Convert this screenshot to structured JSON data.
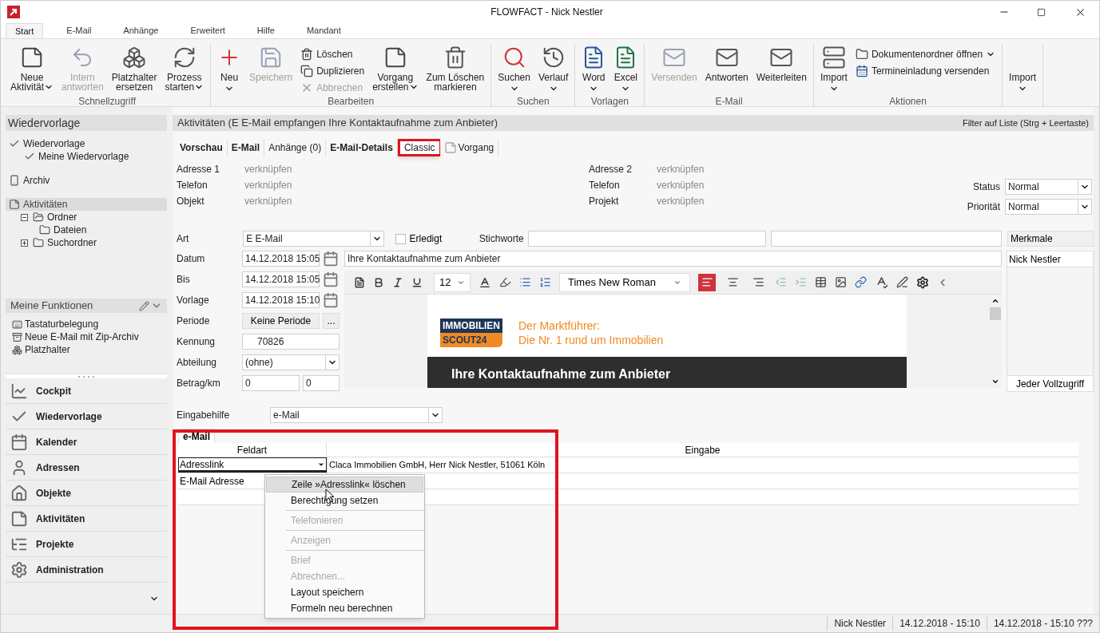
{
  "window": {
    "title": "FLOWFACT - Nick Nestler"
  },
  "ribbon_tabs": [
    {
      "label": "Start",
      "selected": true
    },
    {
      "label": "E-Mail",
      "selected": false
    },
    {
      "label": "Anhänge",
      "selected": false
    },
    {
      "label": "Erweitert",
      "selected": false
    },
    {
      "label": "Hilfe",
      "selected": false
    },
    {
      "label": "Mandant",
      "selected": false
    }
  ],
  "ribbon_groups": [
    {
      "label": "Schnellzugriff",
      "items": [
        {
          "kind": "large",
          "lines": [
            "Neue",
            "Aktivität"
          ],
          "dropdown": true,
          "disabled": false
        },
        {
          "kind": "large",
          "lines": [
            "Intern",
            "antworten"
          ],
          "dropdown": false,
          "disabled": true
        },
        {
          "kind": "large",
          "lines": [
            "Platzhalter",
            "ersetzen"
          ],
          "dropdown": false,
          "disabled": false
        },
        {
          "kind": "large",
          "lines": [
            "Prozess",
            "starten"
          ],
          "dropdown": true,
          "disabled": false
        }
      ]
    },
    {
      "label": "Bearbeiten",
      "items": [
        {
          "kind": "large",
          "lines": [
            "Neu"
          ],
          "dropdown": true,
          "disabled": false
        },
        {
          "kind": "large",
          "lines": [
            "Speichern"
          ],
          "dropdown": false,
          "disabled": true
        },
        {
          "kind": "small",
          "lines": [
            "Löschen"
          ],
          "dropdown": false,
          "disabled": false
        },
        {
          "kind": "small",
          "lines": [
            "Duplizieren"
          ],
          "dropdown": false,
          "disabled": false
        },
        {
          "kind": "small",
          "lines": [
            "Abbrechen"
          ],
          "dropdown": false,
          "disabled": true
        },
        {
          "kind": "large",
          "lines": [
            "Vorgang",
            "erstellen"
          ],
          "dropdown": true,
          "disabled": false
        },
        {
          "kind": "large",
          "lines": [
            "Zum Löschen",
            "markieren"
          ],
          "dropdown": false,
          "disabled": false
        }
      ]
    },
    {
      "label": "Suchen",
      "items": [
        {
          "kind": "large",
          "lines": [
            "Suchen"
          ],
          "dropdown": true,
          "disabled": false
        },
        {
          "kind": "large",
          "lines": [
            "Verlauf"
          ],
          "dropdown": true,
          "disabled": false
        }
      ]
    },
    {
      "label": "Vorlagen",
      "items": [
        {
          "kind": "large",
          "lines": [
            "Word"
          ],
          "dropdown": true,
          "disabled": false
        },
        {
          "kind": "large",
          "lines": [
            "Excel"
          ],
          "dropdown": true,
          "disabled": false
        }
      ]
    },
    {
      "label": "E-Mail",
      "items": [
        {
          "kind": "large",
          "lines": [
            "Versenden"
          ],
          "dropdown": false,
          "disabled": true
        },
        {
          "kind": "large",
          "lines": [
            "Antworten"
          ],
          "dropdown": false,
          "disabled": false
        },
        {
          "kind": "large",
          "lines": [
            "Weiterleiten"
          ],
          "dropdown": false,
          "disabled": false
        }
      ]
    },
    {
      "label": "Aktionen",
      "items": [
        {
          "kind": "large",
          "lines": [
            "Import"
          ],
          "dropdown": true,
          "disabled": false
        },
        {
          "kind": "small",
          "lines": [
            "Dokumentenordner öffnen"
          ],
          "dropdown": true,
          "disabled": false
        },
        {
          "kind": "small",
          "lines": [
            "Termineinladung versenden"
          ],
          "dropdown": false,
          "disabled": false
        }
      ]
    },
    {
      "items": [
        {
          "kind": "large",
          "lines": [
            "Import"
          ],
          "dropdown": true,
          "disabled": false
        }
      ]
    }
  ],
  "sidebar": {
    "title": "Wiedervorlage",
    "tree": [
      {
        "label": "Wiedervorlage",
        "selected": false,
        "children": [
          {
            "label": "Meine Wiedervorlage"
          }
        ]
      },
      {
        "label": "Archiv",
        "selected": false
      },
      {
        "label": "Aktivitäten",
        "selected": true,
        "children": [
          {
            "label": "Ordner",
            "expanded": true,
            "children": [
              {
                "label": "Dateien"
              }
            ]
          },
          {
            "label": "Suchordner",
            "expanded": false
          }
        ]
      }
    ],
    "functions": {
      "title": "Meine Funktionen",
      "items": [
        "Tastaturbelegung",
        "Neue E-Mail mit Zip-Archiv",
        "Platzhalter"
      ]
    },
    "nav": [
      "Cockpit",
      "Wiedervorlage",
      "Kalender",
      "Adressen",
      "Objekte",
      "Aktivitäten",
      "Projekte",
      "Administration"
    ]
  },
  "panel": {
    "title": "Aktivitäten (E E-Mail empfangen Ihre Kontaktaufnahme zum Anbieter)",
    "filter_hint": "Filter auf Liste (Strg + Leertaste)",
    "tabs": [
      {
        "label": "Vorschau",
        "bold": true,
        "annotated": false
      },
      {
        "label": "E-Mail",
        "bold": true,
        "annotated": false
      },
      {
        "label": "Anhänge (0)",
        "bold": false,
        "annotated": false
      },
      {
        "label": "E-Mail-Details",
        "bold": true,
        "annotated": false
      },
      {
        "label": "Classic",
        "bold": false,
        "annotated": true
      },
      {
        "label": "Vorgang",
        "bold": false,
        "annotated": false
      }
    ],
    "links_left": [
      {
        "label": "Adresse 1",
        "value": "verknüpfen"
      },
      {
        "label": "Telefon",
        "value": "verknüpfen"
      },
      {
        "label": "Objekt",
        "value": "verknüpfen"
      }
    ],
    "links_right": [
      {
        "label": "Adresse 2",
        "value": "verknüpfen"
      },
      {
        "label": "Telefon",
        "value": "verknüpfen"
      },
      {
        "label": "Projekt",
        "value": "verknüpfen"
      }
    ],
    "status": {
      "label": "Status",
      "value": "Normal"
    },
    "priority": {
      "label": "Priorität",
      "value": "Normal"
    },
    "art": {
      "label": "Art",
      "value": "E E-Mail"
    },
    "done": {
      "label": "Erledigt",
      "checked": false
    },
    "keywords": {
      "label": "Stichworte"
    },
    "dates": [
      {
        "label": "Datum",
        "value": "14.12.2018 15:05"
      },
      {
        "label": "Bis",
        "value": "14.12.2018 15:05"
      },
      {
        "label": "Vorlage",
        "value": "14.12.2018 15:10"
      }
    ],
    "period": {
      "label": "Periode",
      "value": "Keine Periode",
      "more": "..."
    },
    "kennung": {
      "label": "Kennung",
      "value": "70826"
    },
    "department": {
      "label": "Abteilung",
      "value": "(ohne)"
    },
    "amount": {
      "label": "Betrag/km",
      "values": [
        "0",
        "0"
      ]
    },
    "subject": "Ihre Kontaktaufnahme zum Anbieter",
    "editor": {
      "font_size": "12",
      "font": "Times New Roman",
      "alignment_buttons": [
        {
          "selected": true
        },
        {
          "selected": false
        },
        {
          "selected": false
        }
      ]
    },
    "email_preview": {
      "logo_top": "IMMOBILIEN",
      "logo_bottom": "SCOUT24",
      "tagline": [
        "Der Marktführer:",
        "Die Nr. 1 rund um Immobilien"
      ],
      "banner": "Ihre Kontaktaufnahme zum Anbieter"
    },
    "attributes": {
      "title": "Merkmale",
      "items": [
        "Nick Nestler"
      ],
      "footer": "Jeder Vollzugriff"
    },
    "input_help": {
      "label": "Eingabehilfe",
      "value": "e-Mail"
    },
    "grid": {
      "annotated": true,
      "tab": "e-Mail",
      "columns": [
        "Feldart",
        "Eingabe"
      ],
      "rows": [
        {
          "feldart": "Adresslink",
          "eingabe": "Claca Immobilien GmbH, Herr Nick Nestler, 51061 Köln",
          "editing": true
        },
        {
          "feldart": "E-Mail Adresse",
          "editing": false
        }
      ]
    },
    "context_menu": [
      {
        "label": "Zeile »Adresslink« löschen",
        "selected": true,
        "disabled": false,
        "separator": false
      },
      {
        "label": "Berechtigung setzen",
        "selected": false,
        "disabled": false,
        "separator": false
      },
      {
        "label": "Telefonieren",
        "selected": false,
        "disabled": true,
        "separator": true
      },
      {
        "label": "Anzeigen",
        "selected": false,
        "disabled": true,
        "separator": true
      },
      {
        "label": "Brief",
        "selected": false,
        "disabled": true,
        "separator": true
      },
      {
        "label": "Abrechnen...",
        "selected": false,
        "disabled": true,
        "separator": false
      },
      {
        "label": "Layout speichern",
        "selected": false,
        "disabled": false,
        "separator": false
      },
      {
        "label": "Formeln neu berechnen",
        "selected": false,
        "disabled": false,
        "separator": false
      }
    ]
  },
  "status_bar": [
    "Nick Nestler",
    "14.12.2018 - 15:10",
    "14.12.2018 - 15:10 ???"
  ]
}
